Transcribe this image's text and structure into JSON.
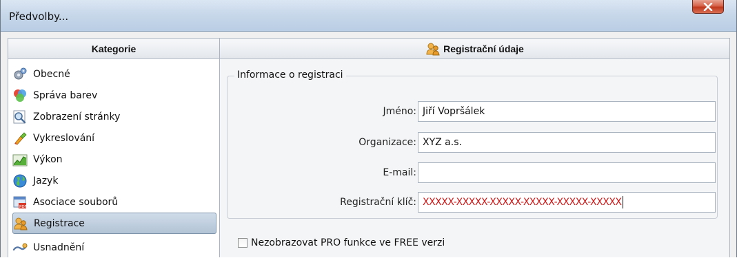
{
  "window": {
    "title": "Předvolby..."
  },
  "sidebar": {
    "header": "Kategorie",
    "items": [
      {
        "label": "Obecné",
        "icon": "gears-icon"
      },
      {
        "label": "Správa barev",
        "icon": "color-circles-icon"
      },
      {
        "label": "Zobrazení stránky",
        "icon": "magnifier-icon"
      },
      {
        "label": "Vykreslování",
        "icon": "paint-brush-icon"
      },
      {
        "label": "Výkon",
        "icon": "performance-chart-icon"
      },
      {
        "label": "Jazyk",
        "icon": "globe-icon"
      },
      {
        "label": "Asociace souborů",
        "icon": "file-association-icon"
      },
      {
        "label": "Registrace",
        "icon": "users-key-icon",
        "selected": true
      },
      {
        "label": "Usnadnění",
        "icon": "accessibility-icon"
      }
    ]
  },
  "main": {
    "header": "Registrační údaje",
    "group_title": "Informace o registraci",
    "fields": {
      "name": {
        "label": "Jméno:",
        "value": "Jiří Vopršálek"
      },
      "organization": {
        "label": "Organizace:",
        "value": "XYZ a.s."
      },
      "email": {
        "label": "E-mail:",
        "value": ""
      },
      "key": {
        "label": "Registrační klíč:",
        "value": "XXXXX-XXXXX-XXXXX-XXXXX-XXXXX-XXXXX"
      }
    },
    "checkbox": {
      "label": "Nezobrazovat PRO funkce ve FREE verzi",
      "checked": false
    }
  },
  "colors": {
    "selection": "#b3c4d6",
    "key_text": "#d01818",
    "close_button": "#c0391f"
  }
}
